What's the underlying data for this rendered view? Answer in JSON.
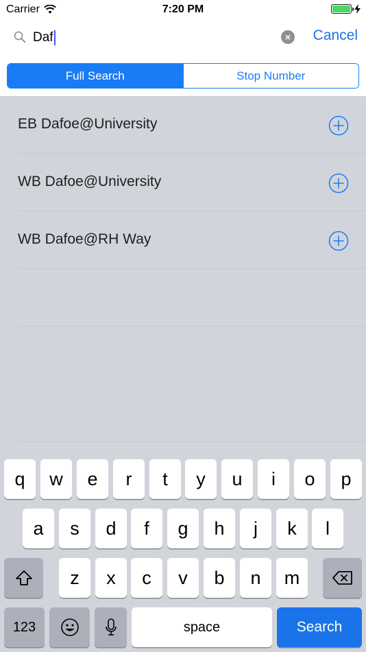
{
  "status_bar": {
    "carrier": "Carrier",
    "time": "7:20 PM"
  },
  "search": {
    "query": "Daf",
    "cancel_label": "Cancel"
  },
  "segments": [
    {
      "label": "Full Search",
      "active": true
    },
    {
      "label": "Stop Number",
      "active": false
    }
  ],
  "results": [
    {
      "label": "EB Dafoe@University"
    },
    {
      "label": "WB Dafoe@University"
    },
    {
      "label": "WB Dafoe@RH Way"
    }
  ],
  "keyboard": {
    "row1": [
      "q",
      "w",
      "e",
      "r",
      "t",
      "y",
      "u",
      "i",
      "o",
      "p"
    ],
    "row2": [
      "a",
      "s",
      "d",
      "f",
      "g",
      "h",
      "j",
      "k",
      "l"
    ],
    "row3": [
      "z",
      "x",
      "c",
      "v",
      "b",
      "n",
      "m"
    ],
    "numbers_label": "123",
    "space_label": "space",
    "search_label": "Search"
  },
  "colors": {
    "accent": "#1a7cf5",
    "list_background": "#d1d5db",
    "battery": "#4cd964"
  }
}
